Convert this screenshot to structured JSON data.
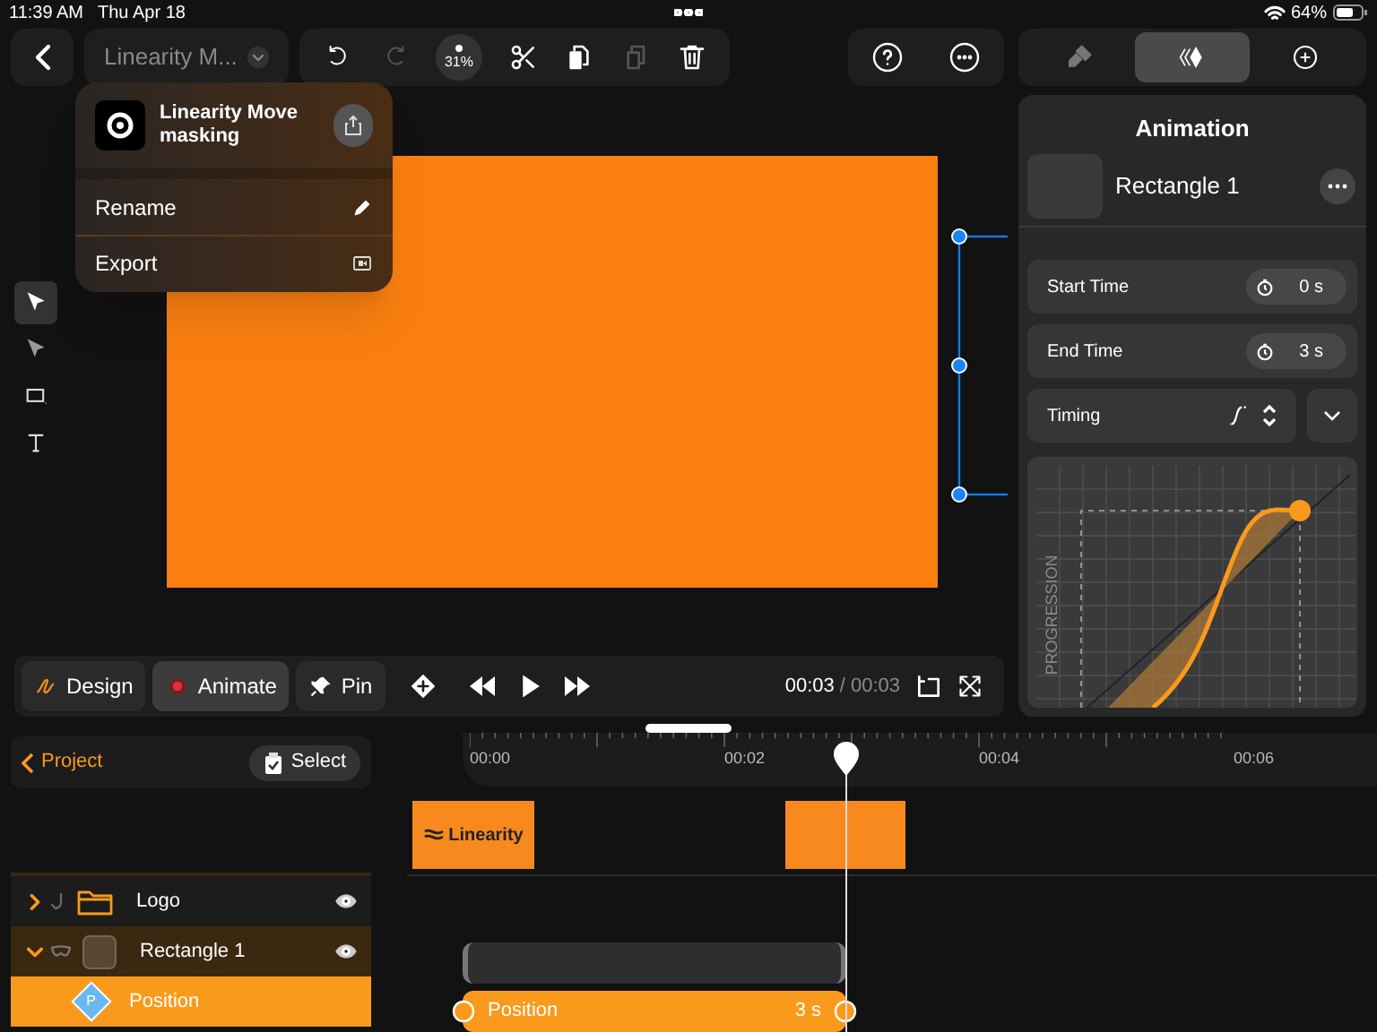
{
  "status_bar": {
    "time": "11:39 AM",
    "date": "Thu Apr 18",
    "battery": "64%"
  },
  "toolbar": {
    "document_title": "Linearity M...",
    "zoom": "31%"
  },
  "panel_tabs": [
    {
      "kind": "style",
      "selected": false
    },
    {
      "kind": "animation",
      "selected": true
    },
    {
      "kind": "add",
      "selected": false
    }
  ],
  "document_menu": {
    "title": "Linearity Move masking",
    "items": [
      {
        "label": "Rename",
        "kind": "rename"
      },
      {
        "label": "Export",
        "kind": "export"
      }
    ]
  },
  "tools": [
    {
      "kind": "select",
      "selected": true
    },
    {
      "kind": "direct",
      "selected": false
    },
    {
      "kind": "rectangle",
      "selected": false
    },
    {
      "kind": "text",
      "selected": false
    }
  ],
  "animation_panel": {
    "title": "Animation",
    "layer": "Rectangle 1",
    "fields": [
      {
        "label": "Start Time",
        "value": "0 s"
      },
      {
        "label": "End Time",
        "value": "3 s"
      }
    ],
    "timing": "Timing",
    "graph_label": "PROGRESSION"
  },
  "playback": {
    "modes": [
      {
        "label": "Design",
        "kind": "design",
        "selected": false
      },
      {
        "label": "Animate",
        "kind": "animate",
        "selected": true
      },
      {
        "label": "Pin",
        "kind": "pin",
        "selected": false
      }
    ],
    "current": "00:03",
    "total": "/ 00:03"
  },
  "timeline": {
    "back": "Project",
    "select": "Select",
    "ruler": [
      "00:00",
      "00:02",
      "00:04",
      "00:06"
    ],
    "logo_clip": "Linearity",
    "layers": [
      {
        "name": "Logo",
        "kind": "folder",
        "expanded": false,
        "selected": false
      },
      {
        "name": "Rectangle 1",
        "kind": "shape",
        "expanded": true,
        "selected": false,
        "children": [
          {
            "name": "Position",
            "kind": "property",
            "icon_letter": "P",
            "selected": true
          }
        ]
      }
    ],
    "track": {
      "label": "Position",
      "duration": "3 s"
    }
  }
}
